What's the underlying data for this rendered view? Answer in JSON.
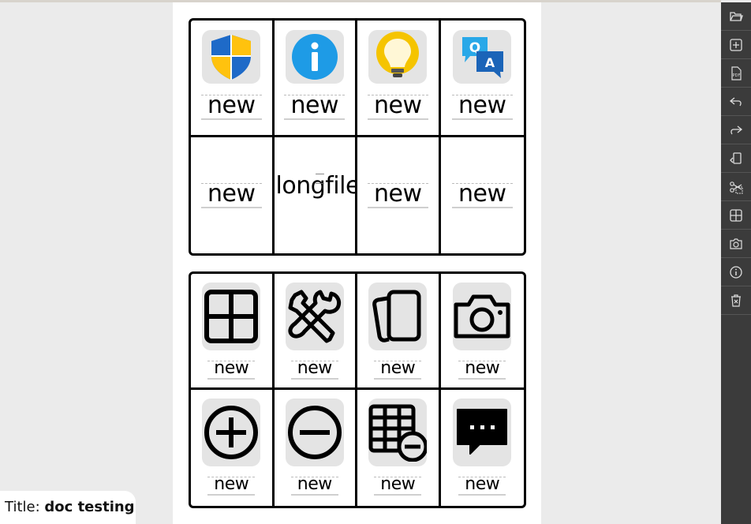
{
  "document": {
    "title_label": "Title:",
    "title_value": "doc testing"
  },
  "grid_top": {
    "row1": [
      {
        "label": "new",
        "icon": "shield-icon"
      },
      {
        "label": "new",
        "icon": "info-icon"
      },
      {
        "label": "new",
        "icon": "lightbulb-icon"
      },
      {
        "label": "new",
        "icon": "qa-chat-icon"
      }
    ],
    "row2": [
      {
        "label": "new"
      },
      {
        "label": "longfile"
      },
      {
        "label": "new"
      },
      {
        "label": "new"
      }
    ]
  },
  "grid_bottom": {
    "row1": [
      {
        "label": "new",
        "icon": "grid-icon"
      },
      {
        "label": "new",
        "icon": "tools-icon"
      },
      {
        "label": "new",
        "icon": "cards-icon"
      },
      {
        "label": "new",
        "icon": "camera-icon"
      }
    ],
    "row2": [
      {
        "label": "new",
        "icon": "plus-circle-icon"
      },
      {
        "label": "new",
        "icon": "minus-circle-icon"
      },
      {
        "label": "new",
        "icon": "table-remove-icon"
      },
      {
        "label": "new",
        "icon": "message-icon"
      }
    ]
  },
  "toolbar": {
    "tools": [
      "folder-open-icon",
      "add-page-icon",
      "pdf-icon",
      "undo-icon",
      "redo-icon",
      "rotate-page-icon",
      "cut-icon",
      "layout-grid-icon",
      "camera-icon",
      "info-icon",
      "delete-icon"
    ]
  }
}
